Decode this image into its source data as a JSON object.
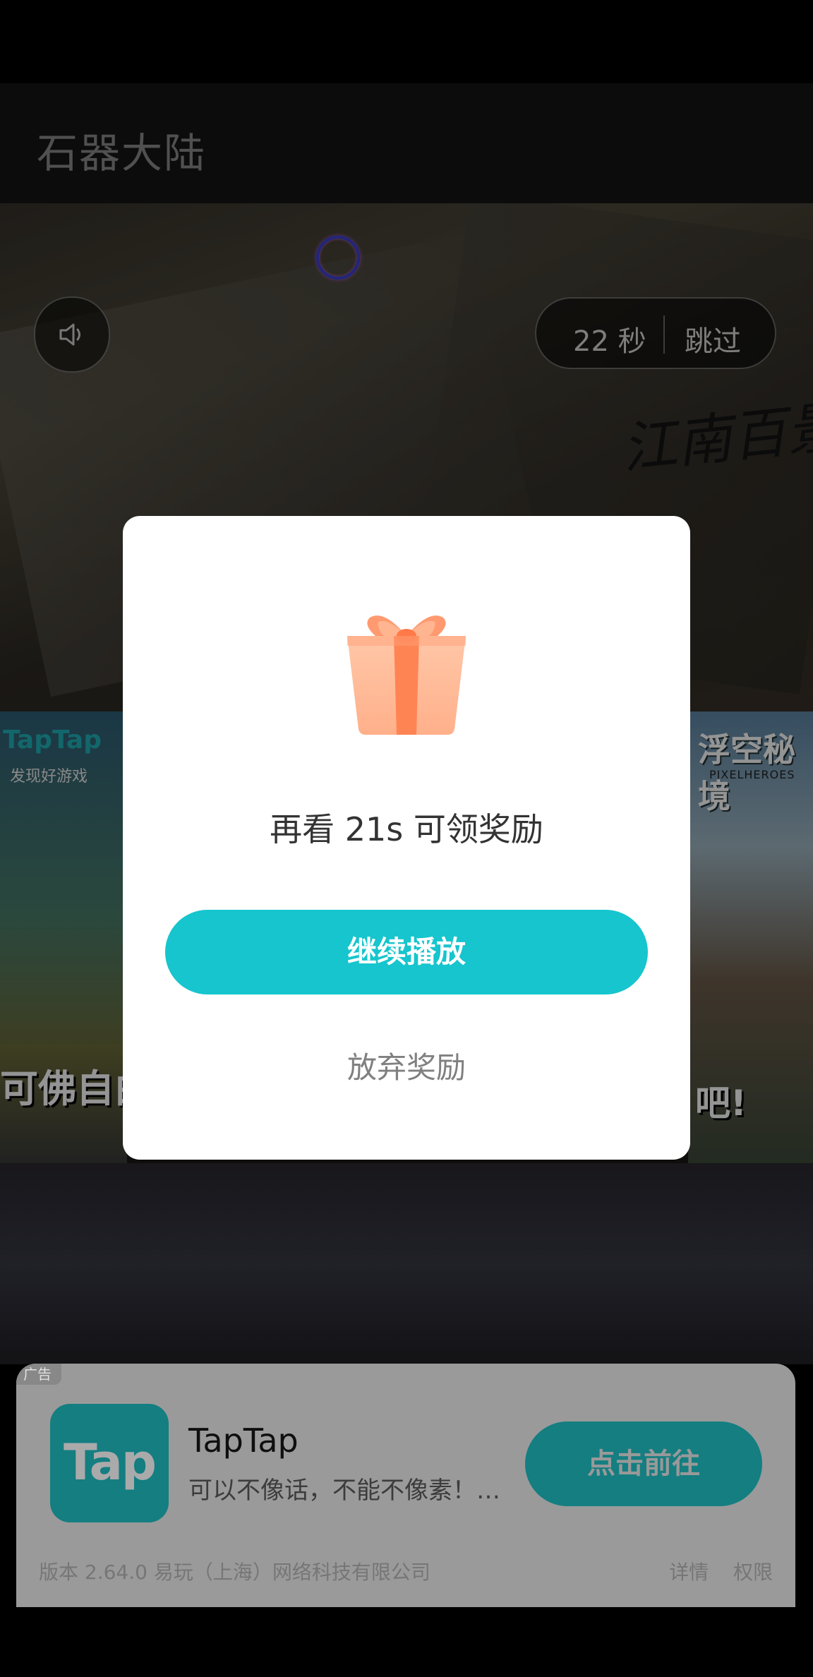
{
  "header": {
    "title": "石器大陆"
  },
  "video": {
    "timer_text": "22 秒",
    "skip_label": "跳过",
    "calligraphy": "江南百景",
    "left_brand": "TapTap",
    "left_sub": "发现好游戏",
    "left_slogan": "可佛自由",
    "right_brand": "浮空秘境",
    "right_sub": "PIXELHEROES",
    "right_bang": "吧!"
  },
  "dialog": {
    "message": "再看 21s 可领奖励",
    "continue_label": "继续播放",
    "abandon_label": "放弃奖励"
  },
  "ad": {
    "badge": "广告",
    "app_icon_text": "Tap",
    "app_name": "TapTap",
    "description": "可以不像话，不能不像素！…",
    "cta_label": "点击前往",
    "meta": "版本 2.64.0   易玩（上海）网络科技有限公司",
    "details_label": "详情",
    "permissions_label": "权限"
  },
  "colors": {
    "accent": "#16c5cd",
    "ad_accent": "#147e81",
    "gift": "#ff8a5c"
  }
}
